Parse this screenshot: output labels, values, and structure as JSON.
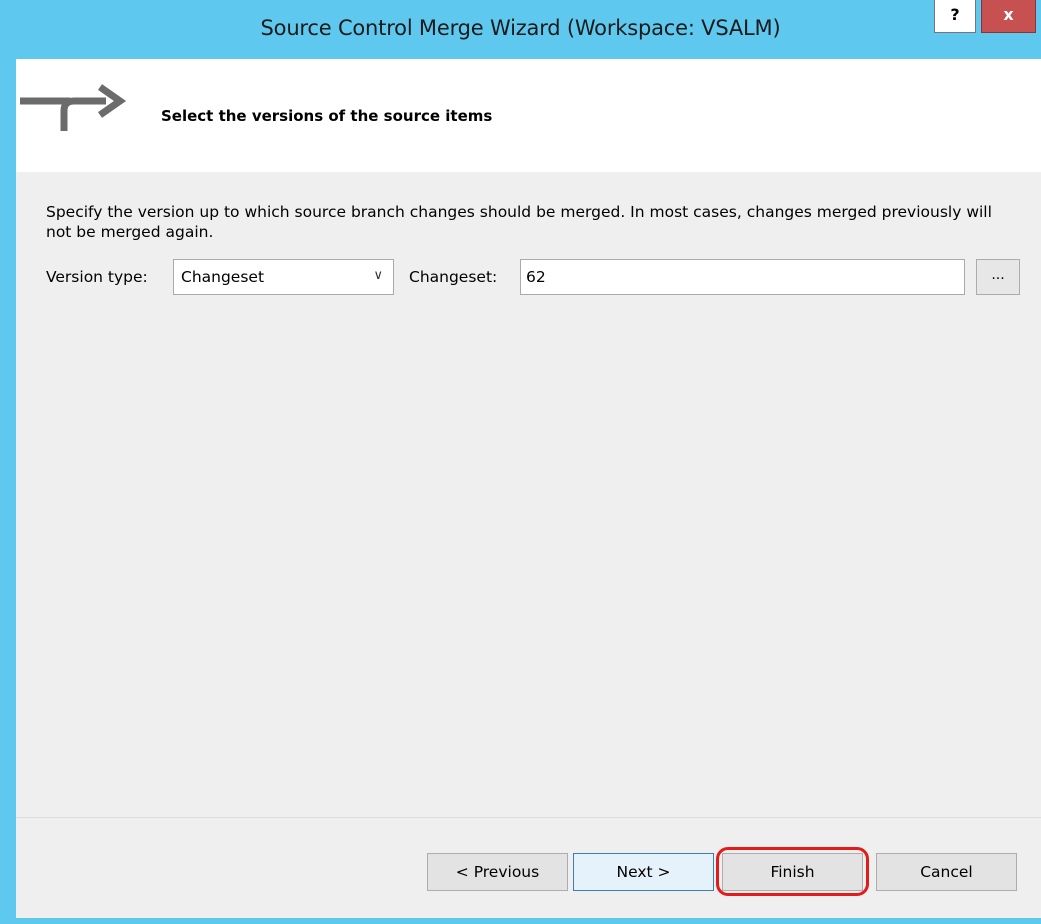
{
  "window": {
    "title": "Source Control Merge Wizard (Workspace: VSALM)",
    "help_label": "?",
    "close_label": "x",
    "accent": "#5ec8ef"
  },
  "header": {
    "icon": "merge-arrow-icon",
    "title": "Select the versions of the source items"
  },
  "content": {
    "description": "Specify the version up to which source branch changes should be merged.  In most cases, changes merged previously will not be merged again.",
    "version_type_label": "Version type:",
    "version_type_value": "Changeset",
    "changeset_label": "Changeset:",
    "changeset_value": "62",
    "browse_label": "..."
  },
  "footer": {
    "previous_label": "< Previous",
    "next_label": "Next >",
    "finish_label": "Finish",
    "cancel_label": "Cancel",
    "highlight_color": "#e31b1b"
  }
}
